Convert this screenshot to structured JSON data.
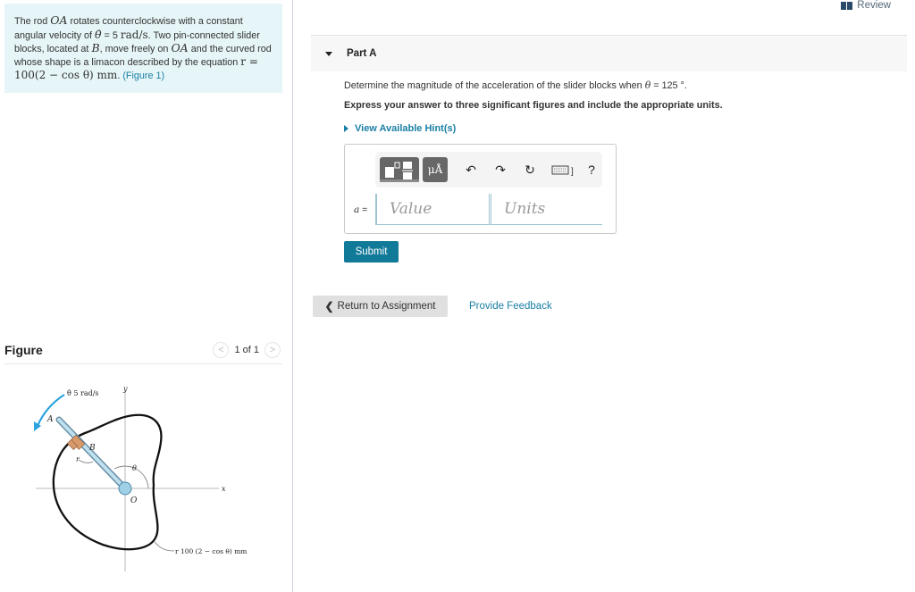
{
  "problem": {
    "text_1": "The rod ",
    "rod_label": "OA",
    "text_2": " rotates counterclockwise with a constant angular velocity of ",
    "theta_dot": "θ̇",
    "text_3": " = 5 ",
    "units_rad": "rad/s",
    "text_4": ". Two pin-connected slider blocks, located at ",
    "point_b": "B",
    "text_5": ", move freely on ",
    "rod_label_2": "OA",
    "text_6": " and the curved rod whose shape is a limacon described by the equation ",
    "equation": "r = 100(2 − cos θ) mm",
    "text_7": ". ",
    "figure_link": "(Figure 1)"
  },
  "figure": {
    "title": "Figure",
    "counter": "1 of 1",
    "prev_icon": "chevron-left-icon",
    "next_icon": "chevron-right-icon",
    "labels": {
      "theta_dot": "θ̇  5 rad/s",
      "y": "y",
      "x": "x",
      "a": "A",
      "b": "B",
      "r": "r",
      "theta": "θ",
      "o": "O",
      "curve_eq": "r  100 (2 − cos θ) mm"
    }
  },
  "review": {
    "label": "Review",
    "icon": "book-icon"
  },
  "part_a": {
    "title": "Part A",
    "question_pre": "Determine the magnitude of the acceleration of the slider blocks when ",
    "question_var": "θ",
    "question_post": " = 125 °.",
    "instructions": "Express your answer to three significant figures and include the appropriate units.",
    "hints_label": "View Available Hint(s)",
    "answer": {
      "variable": "a",
      "equals": " =",
      "value_placeholder": "Value",
      "units_placeholder": "Units",
      "toolbar": {
        "units_button": "μÅ",
        "undo": "↶",
        "redo": "↷",
        "reset": "↻",
        "help": "?"
      }
    },
    "submit_label": "Submit"
  },
  "footer": {
    "return_label": "Return to Assignment",
    "feedback_label": "Provide Feedback"
  }
}
